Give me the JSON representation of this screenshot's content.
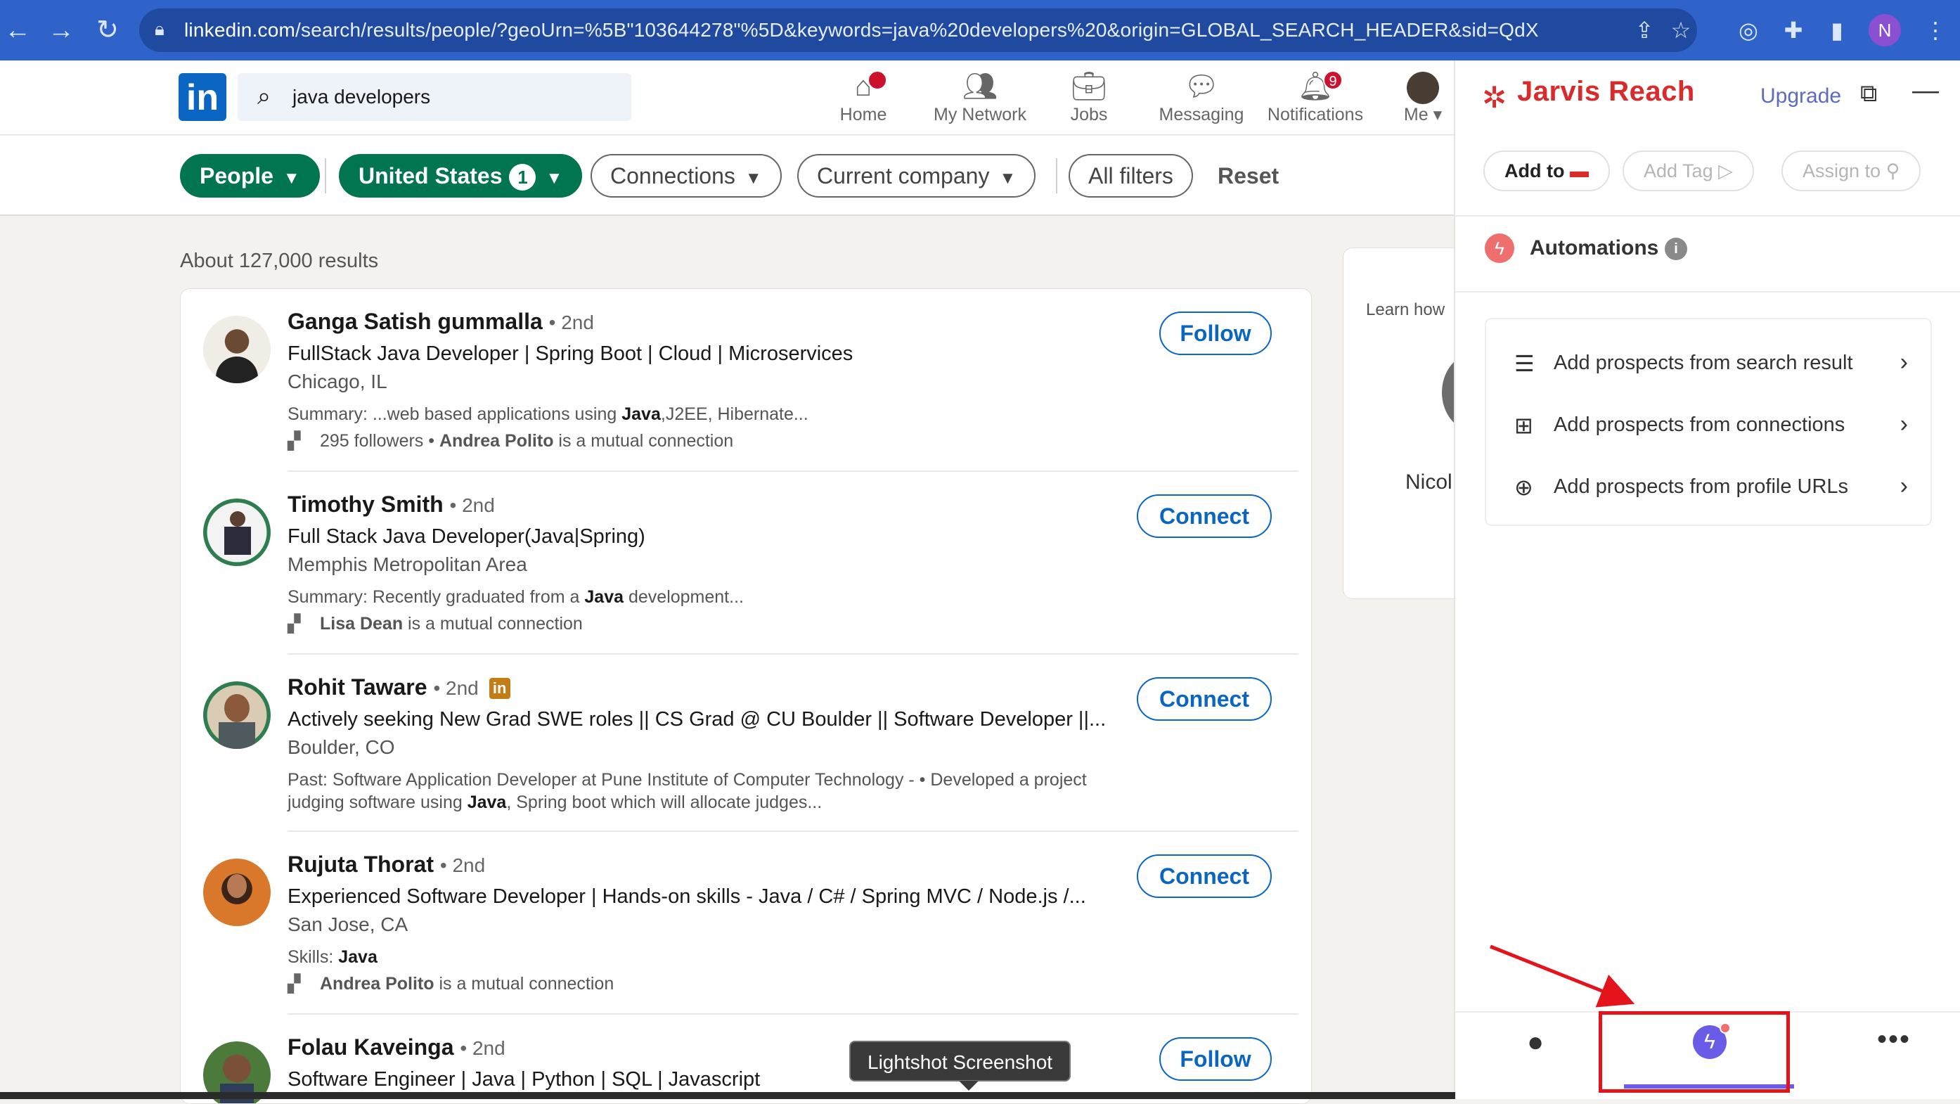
{
  "browser": {
    "url_host": "linkedin.com",
    "url_path": "/search/results/people/?geoUrn=%5B\"103644278\"%5D&keywords=java%20developers%20&origin=GLOBAL_SEARCH_HEADER&sid=QdX",
    "profile_initial": "N"
  },
  "linkedin": {
    "logo": "in",
    "search_value": "java developers",
    "nav": [
      {
        "label": "Home",
        "icon": "home-icon"
      },
      {
        "label": "My Network",
        "icon": "network-icon"
      },
      {
        "label": "Jobs",
        "icon": "briefcase-icon"
      },
      {
        "label": "Messaging",
        "icon": "chat-icon"
      },
      {
        "label": "Notifications",
        "icon": "bell-icon",
        "badge": "9"
      },
      {
        "label": "Me",
        "icon": "avatar"
      }
    ],
    "filters": {
      "people": "People",
      "location": "United States",
      "location_count": "1",
      "connections": "Connections",
      "current_company": "Current company",
      "all_filters": "All filters",
      "reset": "Reset"
    },
    "results_count": "About 127,000 results",
    "results": [
      {
        "name": "Ganga Satish gummalla",
        "degree": "• 2nd",
        "headline": "FullStack Java Developer | Spring Boot | Cloud | Microservices",
        "location": "Chicago, IL",
        "summary_pre": "Summary: ...web based applications using ",
        "summary_bold": "Java",
        "summary_post": ",J2EE, Hibernate...",
        "mutual_pre": "295 followers • ",
        "mutual_bold": "Andrea Polito",
        "mutual_post": " is a mutual connection",
        "action": "Follow"
      },
      {
        "name": "Timothy Smith",
        "degree": "• 2nd",
        "headline": "Full Stack Java Developer(Java|Spring)",
        "location": "Memphis Metropolitan Area",
        "summary_pre": "Summary: Recently graduated from a ",
        "summary_bold": "Java",
        "summary_post": " development...",
        "mutual_pre": "",
        "mutual_bold": "Lisa Dean",
        "mutual_post": " is a mutual connection",
        "action": "Connect"
      },
      {
        "name": "Rohit Taware",
        "degree": "• 2nd",
        "headline": "Actively seeking New Grad SWE roles || CS Grad @ CU Boulder || Software Developer ||...",
        "location": "Boulder, CO",
        "summary_pre": "Past: Software Application Developer at Pune Institute of Computer Technology - • Developed a project judging software using ",
        "summary_bold": "Java",
        "summary_post": ", Spring boot which will allocate judges...",
        "action": "Connect"
      },
      {
        "name": "Rujuta Thorat",
        "degree": "• 2nd",
        "headline": "Experienced Software Developer | Hands-on skills - Java / C# / Spring MVC / Node.js /...",
        "location": "San Jose, CA",
        "summary_pre": "Skills: ",
        "summary_bold": "Java",
        "summary_post": "",
        "mutual_pre": "",
        "mutual_bold": "Andrea Polito",
        "mutual_post": " is a mutual connection",
        "action": "Connect"
      },
      {
        "name": "Folau Kaveinga",
        "degree": "• 2nd",
        "headline": "Software Engineer | Java | Python | SQL | Javascript",
        "action": "Follow"
      }
    ],
    "peek": {
      "text": "Learn how",
      "name": "Nicol"
    }
  },
  "jarvis": {
    "title": "Jarvis Reach",
    "upgrade": "Upgrade",
    "add_to": "Add to",
    "add_tag": "Add Tag",
    "assign_to": "Assign to",
    "automations": "Automations",
    "automation_items": [
      {
        "label": "Add prospects from search result",
        "icon": "search-list-icon"
      },
      {
        "label": "Add prospects from connections",
        "icon": "connections-icon"
      },
      {
        "label": "Add prospects from profile URLs",
        "icon": "globe-icon"
      }
    ]
  },
  "tooltip": "Lightshot Screenshot",
  "colors": {
    "linkedin_blue": "#0a66c2",
    "filter_green": "#01754f",
    "jarvis_red": "#d92b2b",
    "jarvis_purple": "#6b5ce7",
    "annotation_red": "#e3141b"
  }
}
